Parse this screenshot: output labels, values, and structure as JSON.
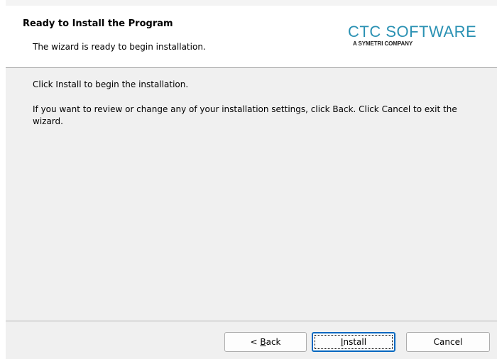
{
  "header": {
    "title": "Ready to Install the Program",
    "subtitle": "The wizard is ready to begin installation.",
    "logo": {
      "main": "CTC SOFTWARE",
      "sub": "A SYMETRI COMPANY",
      "color": "#2a91b3"
    }
  },
  "body": {
    "line1": "Click Install to begin the installation.",
    "line2": "If you want to review or change any of your installation settings, click Back. Click Cancel to exit the wizard."
  },
  "buttons": {
    "back": {
      "prefix": "< ",
      "accel": "B",
      "rest": "ack"
    },
    "install": {
      "prefix": "",
      "accel": "I",
      "rest": "nstall"
    },
    "cancel": {
      "label": "Cancel"
    }
  },
  "colors": {
    "background": "#f0f0f0",
    "header_background": "#ffffff",
    "focus_border": "#0067c0"
  }
}
